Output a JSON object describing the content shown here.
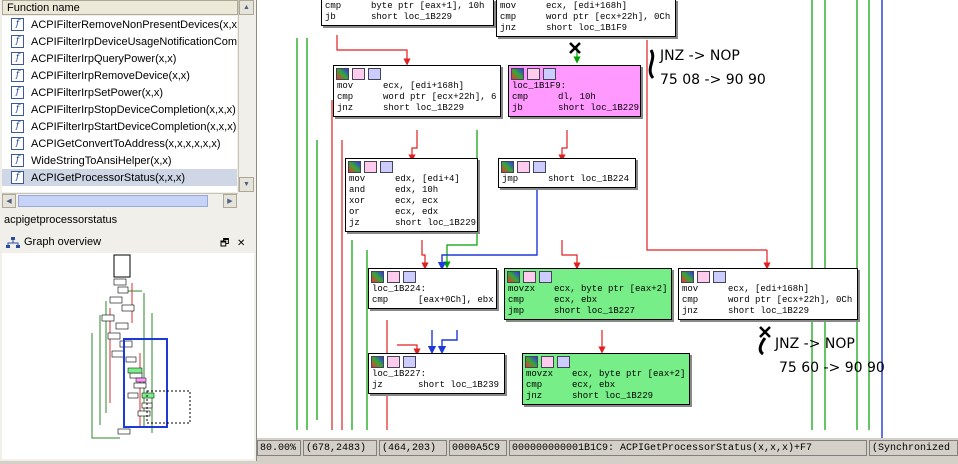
{
  "functions_panel": {
    "header": "Function name",
    "items": [
      "ACPIFilterRemoveNonPresentDevices(x,x)",
      "ACPIFilterIrpDeviceUsageNotificationCompl",
      "ACPIFilterIrpQueryPower(x,x)",
      "ACPIFilterIrpRemoveDevice(x,x)",
      "ACPIFilterIrpSetPower(x,x)",
      "ACPIFilterIrpStopDeviceCompletion(x,x,x)",
      "ACPIFilterIrpStartDeviceCompletion(x,x,x)",
      "ACPIGetConvertToAddress(x,x,x,x,x,x)",
      "WideStringToAnsiHelper(x,x)",
      "ACPIGetProcessorStatus(x,x,x)"
    ],
    "selected_index": 9,
    "icon_glyph": "f",
    "current_function": "acpigetprocessorstatus"
  },
  "graph_overview": {
    "title": "Graph overview",
    "controls": [
      "🗗",
      "✕"
    ]
  },
  "blocks": {
    "b_top_left": [
      {
        "m": "cmp",
        "o": "byte ptr [eax+1], 10h"
      },
      {
        "m": "jb",
        "o": "short loc_1B229"
      }
    ],
    "b_top_right": [
      {
        "m": "mov",
        "o": "ecx, [edi+168h]"
      },
      {
        "m": "cmp",
        "o": "word ptr [ecx+22h], 0Ch"
      },
      {
        "m": "jnz",
        "o": "short loc_1B1F9"
      }
    ],
    "b1": [
      {
        "m": "mov",
        "o": "ecx, [edi+168h]"
      },
      {
        "m": "cmp",
        "o": "word ptr [ecx+22h], 6"
      },
      {
        "m": "jnz",
        "o": "short loc_1B229"
      }
    ],
    "b2": [
      {
        "m": "",
        "o": ""
      },
      {
        "m": "loc_1B1F9:",
        "o": ""
      },
      {
        "m": "cmp",
        "o": "dl, 10h"
      },
      {
        "m": "jb",
        "o": "short loc_1B229"
      }
    ],
    "b3": [
      {
        "m": "mov",
        "o": "edx, [edi+4]"
      },
      {
        "m": "and",
        "o": "edx, 10h"
      },
      {
        "m": "xor",
        "o": "ecx, ecx"
      },
      {
        "m": "or",
        "o": "ecx, edx"
      },
      {
        "m": "jz",
        "o": "short loc_1B229"
      }
    ],
    "b4": [
      {
        "m": "jmp",
        "o": "short loc_1B224"
      }
    ],
    "b5": [
      {
        "m": "",
        "o": ""
      },
      {
        "m": "loc_1B224:",
        "o": ""
      },
      {
        "m": "cmp",
        "o": "[eax+0Ch], ebx"
      }
    ],
    "b6": [
      {
        "m": "movzx",
        "o": "ecx, byte ptr [eax+2]"
      },
      {
        "m": "cmp",
        "o": "ecx, ebx"
      },
      {
        "m": "jmp",
        "o": "short loc_1B227"
      }
    ],
    "b7": [
      {
        "m": "mov",
        "o": "ecx, [edi+168h]"
      },
      {
        "m": "cmp",
        "o": "word ptr [ecx+22h], 0Ch"
      },
      {
        "m": "jnz",
        "o": "short loc_1B229"
      }
    ],
    "b8": [
      {
        "m": "",
        "o": ""
      },
      {
        "m": "loc_1B227:",
        "o": ""
      },
      {
        "m": "jz",
        "o": "short loc_1B239"
      }
    ],
    "b9": [
      {
        "m": "movzx",
        "o": "ecx, byte ptr [eax+2]"
      },
      {
        "m": "cmp",
        "o": "ecx, ebx"
      },
      {
        "m": "jnz",
        "o": "short loc_1B229"
      }
    ]
  },
  "annotations": {
    "note1_line1": "JNZ -> NOP",
    "note1_line2": "75 08 -> 90 90",
    "note2_line1": "JNZ -> NOP",
    "note2_line2": "75 60 -> 90 90"
  },
  "status_bar": {
    "zoom": "80.00%",
    "graph_coords": "(678,2483)",
    "mouse_coords": "(464,203)",
    "file_offset": "0000A5C9",
    "address": "000000000001B1C9: ACPIGetProcessorStatus(x,x,x)+F7",
    "sync": "(Synchronized"
  },
  "colors": {
    "edge_true": "#00a000",
    "edge_false": "#e02020",
    "edge_jump": "#1e3ad6",
    "pink_block": "#ff99ff",
    "green_block": "#77ee88"
  }
}
